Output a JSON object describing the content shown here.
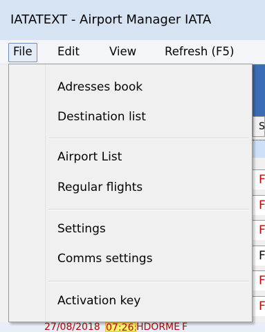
{
  "window": {
    "title": "IATATEXT - Airport Manager IATA"
  },
  "menubar": {
    "file": "File",
    "edit": "Edit",
    "view": "View",
    "refresh": "Refresh (F5)"
  },
  "file_menu": {
    "items": [
      {
        "label": "Adresses book"
      },
      {
        "label": "Destination list"
      },
      {
        "label": "Airport List"
      },
      {
        "label": "Regular flights"
      },
      {
        "label": "Settings"
      },
      {
        "label": "Comms settings"
      },
      {
        "label": "Activation key"
      }
    ]
  },
  "background_grid": {
    "header_letter": "S",
    "cells": [
      "F",
      "F",
      "F",
      "F",
      "F",
      "F"
    ],
    "cell_colors": [
      "#cc0000",
      "#cc0000",
      "#cc0000",
      "#000000",
      "#cc0000",
      "#cc0000"
    ],
    "bottom_row": {
      "date": "27/08/2018",
      "time": "07:26:",
      "code": "HDORME",
      "extra": "F"
    }
  }
}
